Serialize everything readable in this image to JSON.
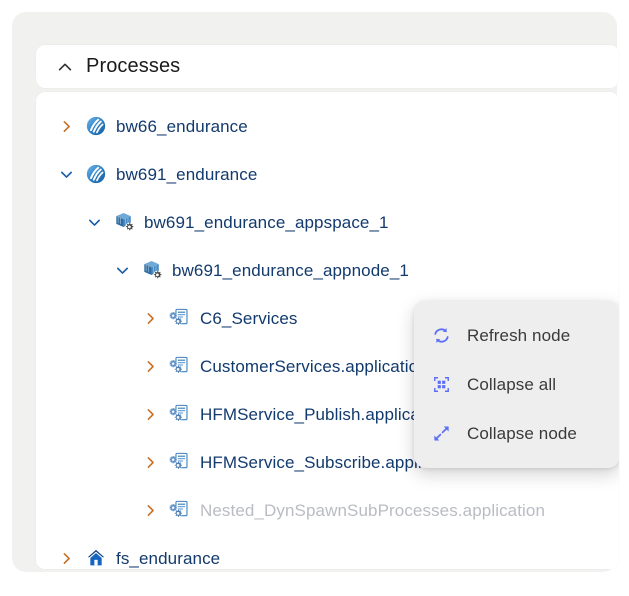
{
  "panel": {
    "header": {
      "title": "Processes",
      "chevron": "chevron-up-icon"
    }
  },
  "tree": {
    "items": [
      {
        "label": "bw66_endurance",
        "level": 0,
        "chevron": "chevron-right-icon",
        "expanded": false,
        "icon": "process-engine-icon",
        "dimmed": false
      },
      {
        "label": "bw691_endurance",
        "level": 0,
        "chevron": "chevron-down-icon",
        "expanded": true,
        "icon": "process-engine-icon",
        "dimmed": false
      },
      {
        "label": "bw691_endurance_appspace_1",
        "level": 1,
        "chevron": "chevron-down-icon",
        "expanded": true,
        "icon": "appspace-icon",
        "dimmed": false
      },
      {
        "label": "bw691_endurance_appnode_1",
        "level": 2,
        "chevron": "chevron-down-icon",
        "expanded": true,
        "icon": "appspace-icon",
        "dimmed": false
      },
      {
        "label": "C6_Services",
        "level": 3,
        "chevron": "chevron-right-icon",
        "expanded": false,
        "icon": "application-icon",
        "dimmed": false
      },
      {
        "label": "CustomerServices.application",
        "level": 3,
        "chevron": "chevron-right-icon",
        "expanded": false,
        "icon": "application-icon",
        "dimmed": false
      },
      {
        "label": "HFMService_Publish.application",
        "level": 3,
        "chevron": "chevron-right-icon",
        "expanded": false,
        "icon": "application-icon",
        "dimmed": false
      },
      {
        "label": "HFMService_Subscribe.application",
        "level": 3,
        "chevron": "chevron-right-icon",
        "expanded": false,
        "icon": "application-icon",
        "dimmed": false
      },
      {
        "label": "Nested_DynSpawnSubProcesses.application",
        "level": 3,
        "chevron": "chevron-right-icon",
        "expanded": false,
        "icon": "application-icon",
        "dimmed": true
      },
      {
        "label": "fs_endurance",
        "level": 0,
        "chevron": "chevron-right-icon",
        "expanded": false,
        "icon": "home-icon",
        "dimmed": false
      }
    ]
  },
  "context_menu": {
    "visible": true,
    "items": [
      {
        "label": "Refresh node",
        "icon": "refresh-icon"
      },
      {
        "label": "Collapse all",
        "icon": "collapse-all-icon"
      },
      {
        "label": "Collapse node",
        "icon": "collapse-node-icon"
      }
    ]
  },
  "colors": {
    "panel_background": "#f1f1f0",
    "card_background": "#ffffff",
    "tree_label": "#123a6d",
    "tree_label_disabled": "#b9bcc2",
    "chevron_collapsed": "#c6722a",
    "chevron_expanded": "#1b5ea6",
    "menu_background": "#eeeeee",
    "menu_icon": "#5b6ef5",
    "menu_label": "#3a3a3a",
    "header_title": "#1b1b1b"
  }
}
